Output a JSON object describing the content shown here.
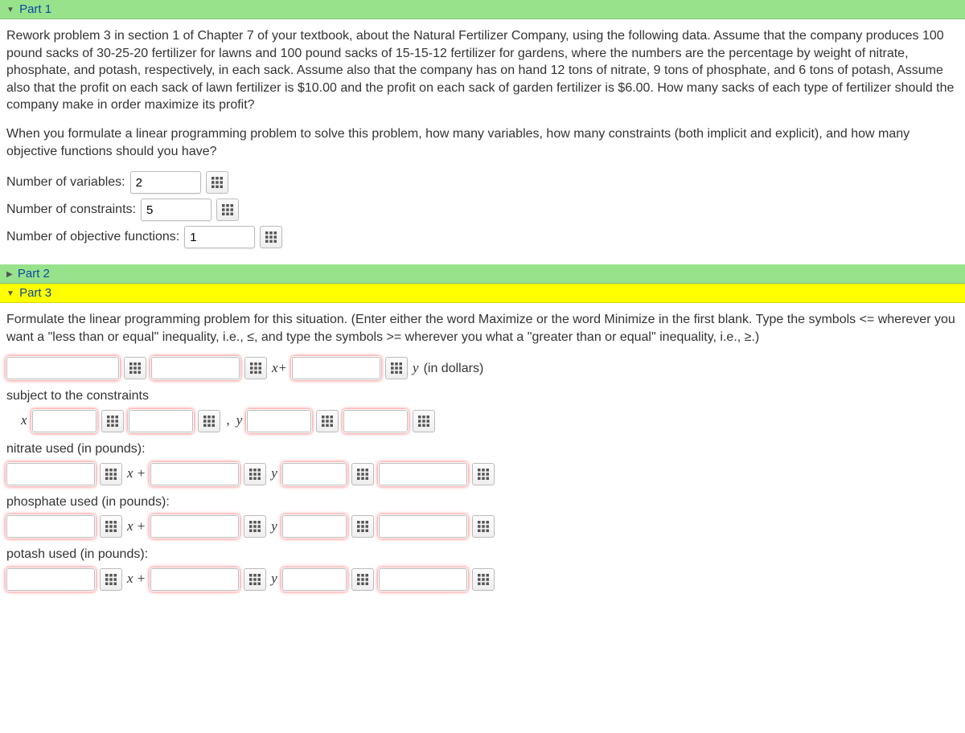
{
  "part1": {
    "title": "Part 1",
    "problem_text": "Rework problem 3 in section 1 of Chapter 7 of your textbook, about the Natural Fertilizer Company, using the following data. Assume that the company produces 100 pound sacks of 30-25-20 fertilizer for lawns and 100 pound sacks of 15-15-12 fertilizer for gardens, where the numbers are the percentage by weight of nitrate, phosphate, and potash, respectively, in each sack. Assume also that the company has on hand 12 tons of nitrate, 9 tons of phosphate, and 6 tons of potash, Assume also that the profit on each sack of lawn fertilizer is $10.00 and the profit on each sack of garden fertilizer is $6.00. How many sacks of each type of fertilizer should the company make in order maximize its profit?",
    "question_text": "When you formulate a linear programming problem to solve this problem, how many variables, how many constraints (both implicit and explicit), and how many objective functions should you have?",
    "labels": {
      "num_variables": "Number of variables:",
      "num_constraints": "Number of constraints:",
      "num_objectives": "Number of objective functions:"
    },
    "values": {
      "num_variables": "2",
      "num_constraints": "5",
      "num_objectives": "1"
    }
  },
  "part2": {
    "title": "Part 2"
  },
  "part3": {
    "title": "Part 3",
    "instructions": "Formulate the linear programming problem for this situation. (Enter either the word Maximize or the word Minimize in the first blank. Type the symbols <= wherever you want a \"less than or equal\" inequality, i.e., ≤, and type the symbols >= wherever you what a \"greater than or equal\" inequality, i.e., ≥.)",
    "objective_suffix": "(in dollars)",
    "subject_to_label": "subject to the constraints",
    "constraint_labels": {
      "nitrate": "nitrate used (in pounds):",
      "phosphate": "phosphate used (in pounds):",
      "potash": "potash used (in pounds):"
    },
    "math": {
      "x": "x",
      "y": "y",
      "xplus": "x+",
      "x_plus": "x +",
      "comma": ","
    }
  }
}
